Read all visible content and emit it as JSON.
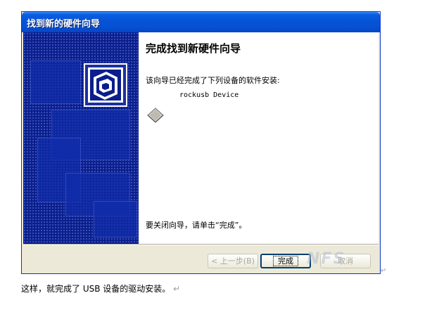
{
  "window": {
    "title": "找到新的硬件向导"
  },
  "content": {
    "heading": "完成找到新硬件向导",
    "description": "该向导已经完成了下列设备的软件安装:",
    "device_name": "rockusb Device",
    "close_note": "要关闭向导，请单击“完成”。"
  },
  "buttons": {
    "back": "< 上一步(B)",
    "finish": "完成",
    "cancel": "取消"
  },
  "caption": {
    "text": "这样，就完成了 USB 设备的驱动安装。",
    "mark": "↵"
  },
  "watermark": "NFS",
  "colors": {
    "titlebar": "#0653d8",
    "banner": "#0a1e8c",
    "dialog_bg": "#ece9d8"
  }
}
